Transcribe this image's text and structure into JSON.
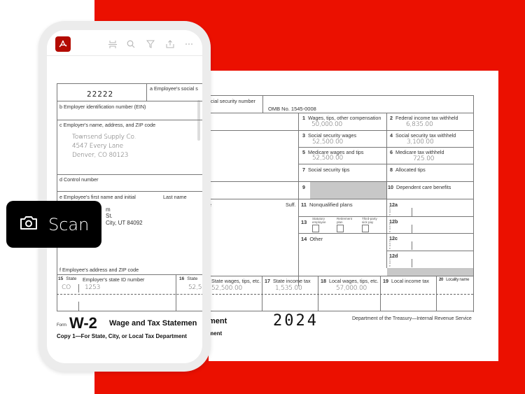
{
  "app": {
    "logo_glyph": "ᴧ",
    "toolbar_icons": [
      "scan-crop-icon",
      "search-icon",
      "filter-icon",
      "share-icon",
      "more-icon"
    ],
    "toolbar_glyphs": [
      "⌶",
      "⚲",
      "▽",
      "⇧",
      "···"
    ]
  },
  "scan_button": {
    "icon": "camera-icon",
    "label": "Scan"
  },
  "colors": {
    "brand_red": "#eb1000",
    "logo_red": "#b30b00"
  },
  "form": {
    "void_code": "22222",
    "a_label": "a Employee's social security number",
    "a_label_partial_phone": "a Employee's social s",
    "a_label_partial_doc": "cial security number",
    "omb": "OMB No. 1545-0008",
    "b_label": "b Employer identification number (EIN)",
    "c_label": "c Employer's name, address, and ZIP code",
    "employer": {
      "name": "Townsend Supply Co.",
      "street": "4547 Every Lane",
      "city": "Denver, CO 80123"
    },
    "d_label": "d Control number",
    "e_label": "e Employee's first name and initial",
    "last_name_label": "Last name",
    "suff_label": "Suff.",
    "employee_partial": {
      "line1": "m",
      "line2": "St.",
      "line3": "City, UT 84092"
    },
    "f_label": "f Employee's address and ZIP code",
    "boxes": {
      "b1": {
        "num": "1",
        "label": "Wages, tips, other compensation",
        "value": "50,000.00"
      },
      "b2": {
        "num": "2",
        "label": "Federal income tax withheld",
        "value": "6,835.00"
      },
      "b3": {
        "num": "3",
        "label": "Social security wages",
        "value": "52,500.00"
      },
      "b4": {
        "num": "4",
        "label": "Social security tax withheld",
        "value": "3,100.00"
      },
      "b5": {
        "num": "5",
        "label": "Medicare wages and tips",
        "value": "52,500.00"
      },
      "b6": {
        "num": "6",
        "label": "Medicare tax withheld",
        "value": "725.00"
      },
      "b7": {
        "num": "7",
        "label": "Social security tips",
        "value": ""
      },
      "b8": {
        "num": "8",
        "label": "Allocated tips",
        "value": ""
      },
      "b9": {
        "num": "9",
        "label": "",
        "value": ""
      },
      "b10": {
        "num": "10",
        "label": "Dependent care benefits",
        "value": ""
      },
      "b11": {
        "num": "11",
        "label": "Nonqualified plans",
        "value": ""
      },
      "b12a": {
        "num": "12a"
      },
      "b12b": {
        "num": "12b"
      },
      "b12c": {
        "num": "12c"
      },
      "b12d": {
        "num": "12d"
      },
      "code_letters": "C\no\nd\ne",
      "b13": {
        "num": "13",
        "statutory": "Statutory employee",
        "retirement": "Retirement plan",
        "thirdparty": "Third-party sick pay"
      },
      "b14": {
        "num": "14",
        "label": "Other"
      },
      "b15": {
        "num": "15",
        "label": "State",
        "state": "CO",
        "id_label": "Employer's state ID number",
        "id": "1253"
      },
      "b16": {
        "num": "16",
        "label": "State wages, tips, etc.",
        "label_partial": "State",
        "value": "52,500.00",
        "value_partial": "52,50"
      },
      "b17": {
        "num": "17",
        "label": "State income tax",
        "value": "1,535.00"
      },
      "b18": {
        "num": "18",
        "label": "Local wages, tips, etc.",
        "value": "57,000.00"
      },
      "b19": {
        "num": "19",
        "label": "Local income tax",
        "value": ""
      },
      "b20": {
        "num": "20",
        "label": "Locality name",
        "value": ""
      }
    },
    "form_word": "Form",
    "form_name": "W-2",
    "title": "Wage and Tax Statement",
    "title_partial_phone": "Wage and Tax Statemen",
    "title_partial_doc": "ment",
    "copy": "Copy 1—For State, City, or Local Tax Department",
    "copy_partial_doc": "ment",
    "year": "2024",
    "dept": "Department of the Treasury—Internal Revenue Service"
  }
}
